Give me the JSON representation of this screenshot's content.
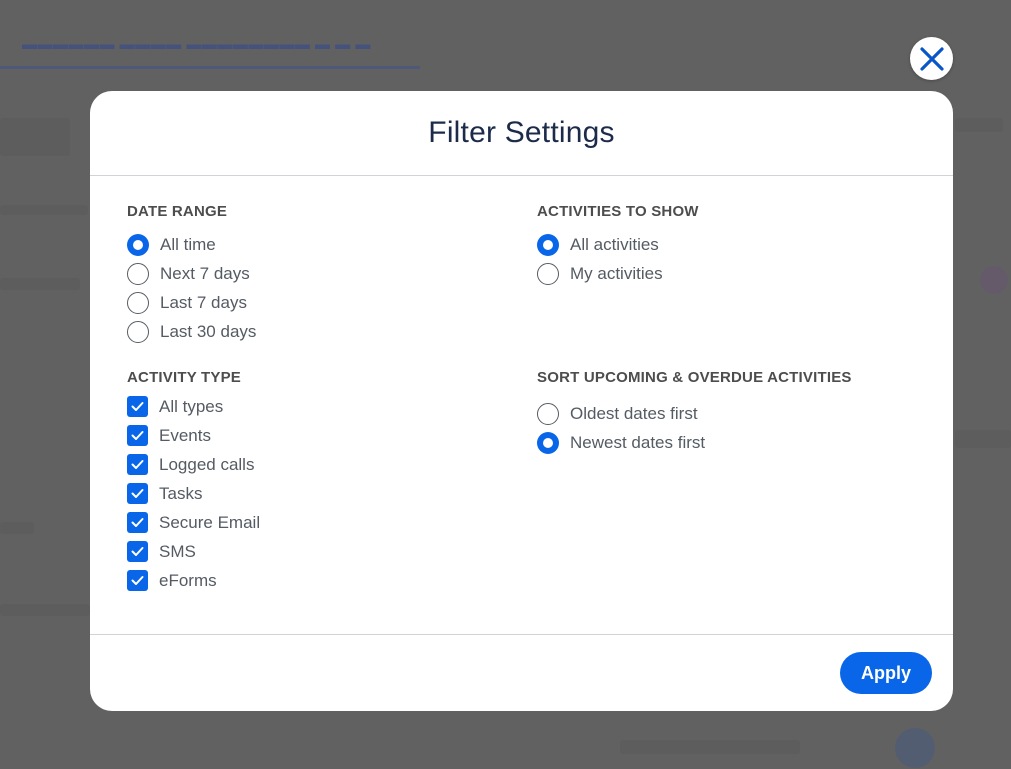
{
  "modal": {
    "title": "Filter Settings",
    "apply_label": "Apply"
  },
  "date_range": {
    "title": "DATE RANGE",
    "options": [
      {
        "label": "All time",
        "selected": true
      },
      {
        "label": "Next 7 days",
        "selected": false
      },
      {
        "label": "Last 7 days",
        "selected": false
      },
      {
        "label": "Last 30 days",
        "selected": false
      }
    ]
  },
  "activities_to_show": {
    "title": "ACTIVITIES TO SHOW",
    "options": [
      {
        "label": "All activities",
        "selected": true
      },
      {
        "label": "My activities",
        "selected": false
      }
    ]
  },
  "activity_type": {
    "title": "ACTIVITY TYPE",
    "options": [
      {
        "label": "All types",
        "checked": true
      },
      {
        "label": "Events",
        "checked": true
      },
      {
        "label": "Logged calls",
        "checked": true
      },
      {
        "label": "Tasks",
        "checked": true
      },
      {
        "label": "Secure Email",
        "checked": true
      },
      {
        "label": "SMS",
        "checked": true
      },
      {
        "label": "eForms",
        "checked": true
      }
    ]
  },
  "sort": {
    "title": "SORT UPCOMING & OVERDUE ACTIVITIES",
    "options": [
      {
        "label": "Oldest dates first",
        "selected": false
      },
      {
        "label": "Newest dates first",
        "selected": true
      }
    ]
  },
  "colors": {
    "accent": "#0a66e8",
    "title_text": "#1c2b4a",
    "label_text": "#555b63",
    "overlay": "#757575"
  },
  "icons": {
    "close": "close-icon",
    "check": "checkmark-icon"
  }
}
